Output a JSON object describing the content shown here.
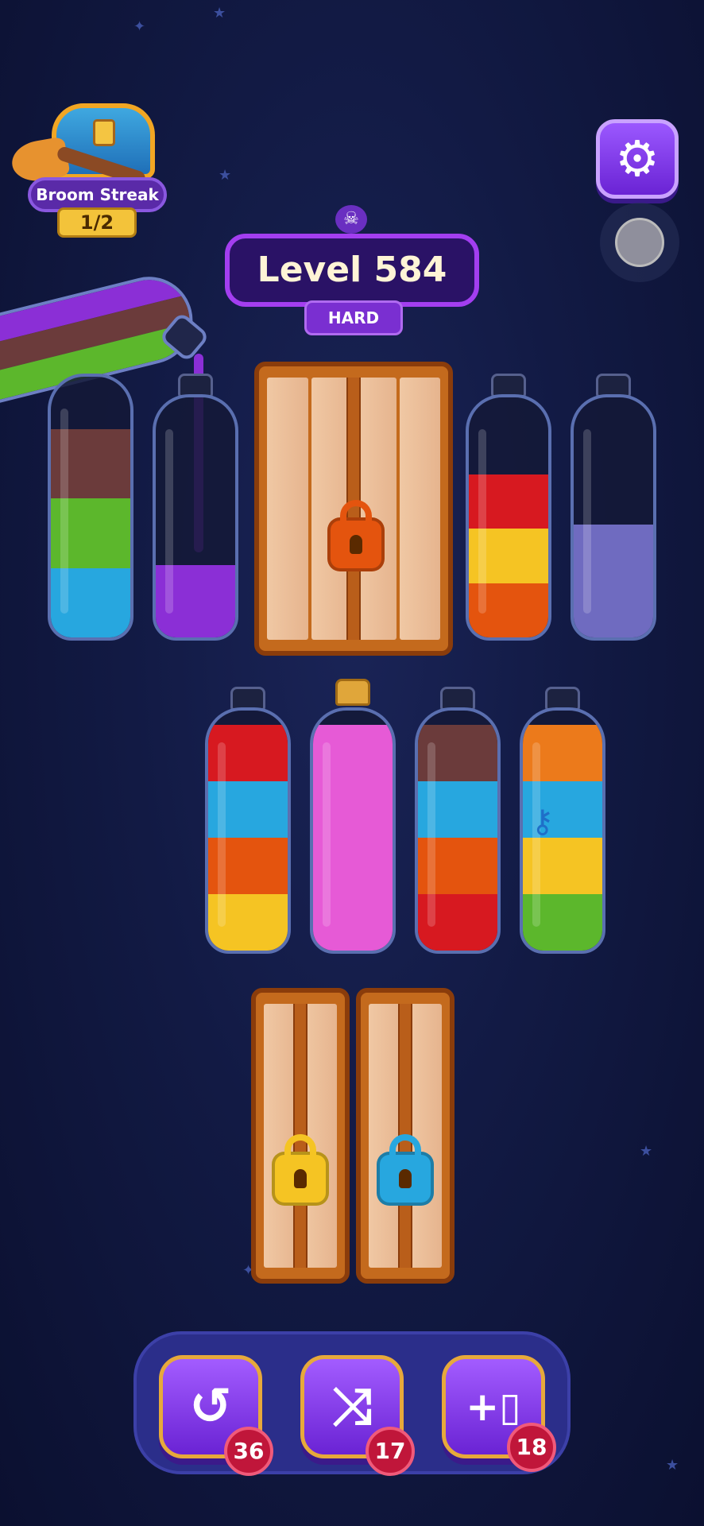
{
  "streak": {
    "title": "Broom Streak",
    "progress": "1/2"
  },
  "settings": {
    "icon": "gear-icon"
  },
  "level": {
    "label": "Level 584",
    "difficulty": "HARD",
    "icon": "skull-icon"
  },
  "pouring": {
    "layers": [
      "#8b2fd6",
      "#6b3b3b",
      "#5cb72c"
    ],
    "stream_color": "#8b2fd6"
  },
  "bottles_row1": [
    {
      "colors": [
        "#27a7df",
        "#5cb72c",
        "#6b3b3b"
      ],
      "fill": 0.8
    },
    {
      "colors": [
        "#8b2fd6"
      ],
      "fill": 0.3
    },
    {
      "colors": [
        "#e4540e",
        "#f5c423",
        "#d71920"
      ],
      "fill": 0.68
    },
    {
      "colors": [
        "#6f6bc0"
      ],
      "fill": 0.47
    }
  ],
  "bottles_row2": [
    {
      "colors": [
        "#f5c423",
        "#e4540e",
        "#27a7df",
        "#d71920"
      ],
      "fill": 0.94,
      "corked": false
    },
    {
      "colors": [
        "#e65ad6"
      ],
      "fill": 0.94,
      "corked": true
    },
    {
      "colors": [
        "#d71920",
        "#e4540e",
        "#27a7df",
        "#6b3b3b"
      ],
      "fill": 0.94,
      "corked": false
    },
    {
      "colors": [
        "#5cb72c",
        "#f5c423",
        "#27a7df",
        "#ec7a1b"
      ],
      "fill": 0.94,
      "corked": false,
      "key_icon": "key-icon"
    }
  ],
  "locks": [
    {
      "color": "#e4540e",
      "icon": "padlock-icon"
    },
    {
      "color": "#f5c423",
      "icon": "padlock-icon"
    },
    {
      "color": "#27a7df",
      "icon": "padlock-icon"
    }
  ],
  "tools": [
    {
      "icon": "undo-icon",
      "count": "36"
    },
    {
      "icon": "shuffle-icon",
      "count": "17"
    },
    {
      "icon": "add-bottle-icon",
      "count": "18"
    }
  ]
}
